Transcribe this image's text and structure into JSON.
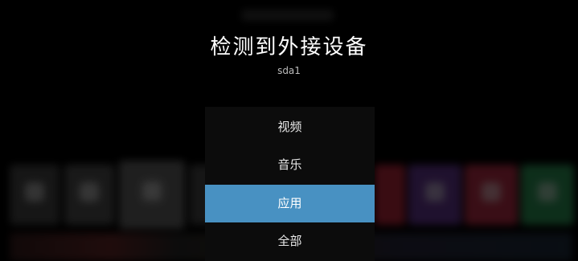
{
  "dialog": {
    "title": "检测到外接设备",
    "device_name": "sda1"
  },
  "menu": {
    "items": [
      {
        "label": "视频"
      },
      {
        "label": "音乐"
      },
      {
        "label": "应用"
      },
      {
        "label": "全部"
      }
    ],
    "selected_label": "应用"
  },
  "colors": {
    "selection": "#4891c2",
    "panel": "#0c0c0c",
    "background": "#000000"
  }
}
